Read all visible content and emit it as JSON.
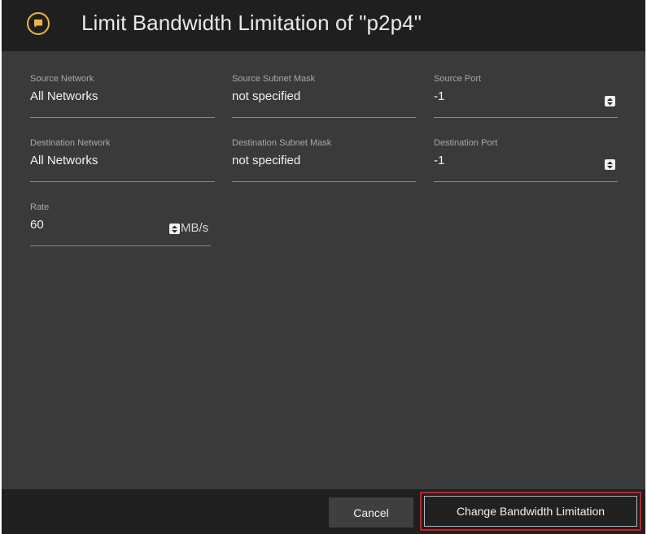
{
  "dialog": {
    "title": "Limit Bandwidth Limitation of \"p2p4\"",
    "icon": "message-icon",
    "accent_color": "#e9b73f"
  },
  "fields": {
    "source_network": {
      "label": "Source Network",
      "value": "All Networks"
    },
    "source_subnet_mask": {
      "label": "Source Subnet Mask",
      "value": "not specified"
    },
    "source_port": {
      "label": "Source Port",
      "value": "-1"
    },
    "destination_network": {
      "label": "Destination Network",
      "value": "All Networks"
    },
    "destination_subnet_mask": {
      "label": "Destination Subnet Mask",
      "value": "not specified"
    },
    "destination_port": {
      "label": "Destination Port",
      "value": "-1"
    },
    "rate": {
      "label": "Rate",
      "value": "60",
      "unit": "MB/s"
    }
  },
  "footer": {
    "cancel_label": "Cancel",
    "submit_label": "Change Bandwidth Limitation",
    "highlight_color": "#d01c1c"
  }
}
